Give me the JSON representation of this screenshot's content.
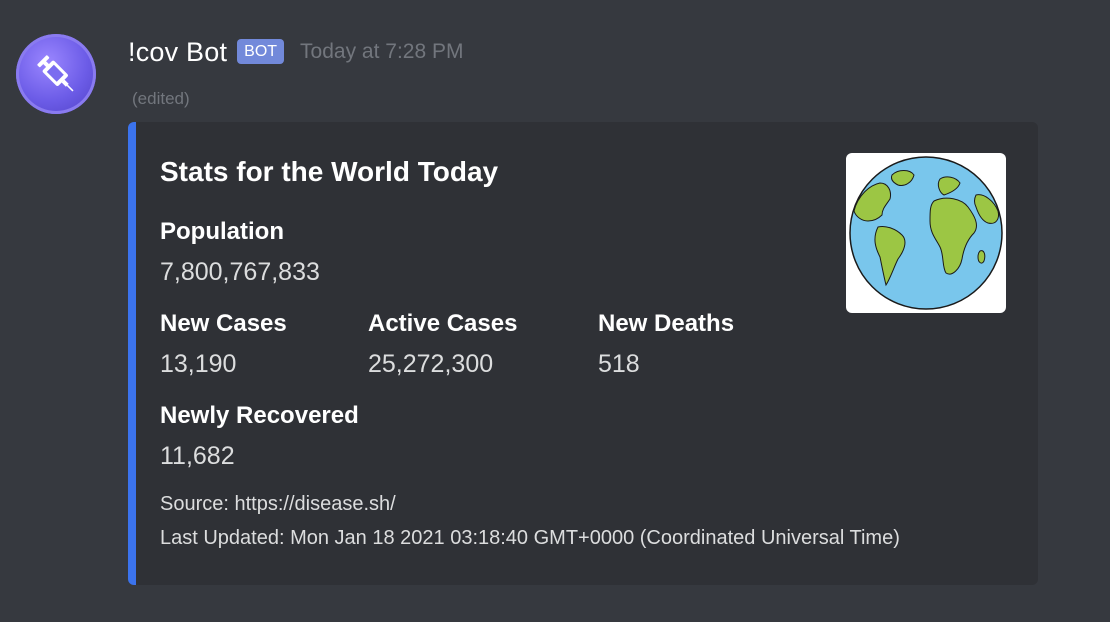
{
  "author": {
    "username": "!cov Bot",
    "bot_tag": "BOT",
    "timestamp": "Today at 7:28 PM",
    "edited_label": "(edited)",
    "avatar_icon": "syringe-icon",
    "avatar_color": "#6c5ce7"
  },
  "embed": {
    "accent_color": "#3b73ed",
    "title": "Stats for the World Today",
    "thumbnail_icon": "globe-icon",
    "fields": {
      "population": {
        "name": "Population",
        "value": "7,800,767,833"
      },
      "new_cases": {
        "name": "New Cases",
        "value": "13,190"
      },
      "active_cases": {
        "name": "Active Cases",
        "value": "25,272,300"
      },
      "new_deaths": {
        "name": "New Deaths",
        "value": "518"
      },
      "newly_recovered": {
        "name": "Newly Recovered",
        "value": "11,682"
      }
    },
    "source": "Source: https://disease.sh/",
    "last_updated": "Last Updated: Mon Jan 18 2021 03:18:40 GMT+0000 (Coordinated Universal Time)"
  }
}
